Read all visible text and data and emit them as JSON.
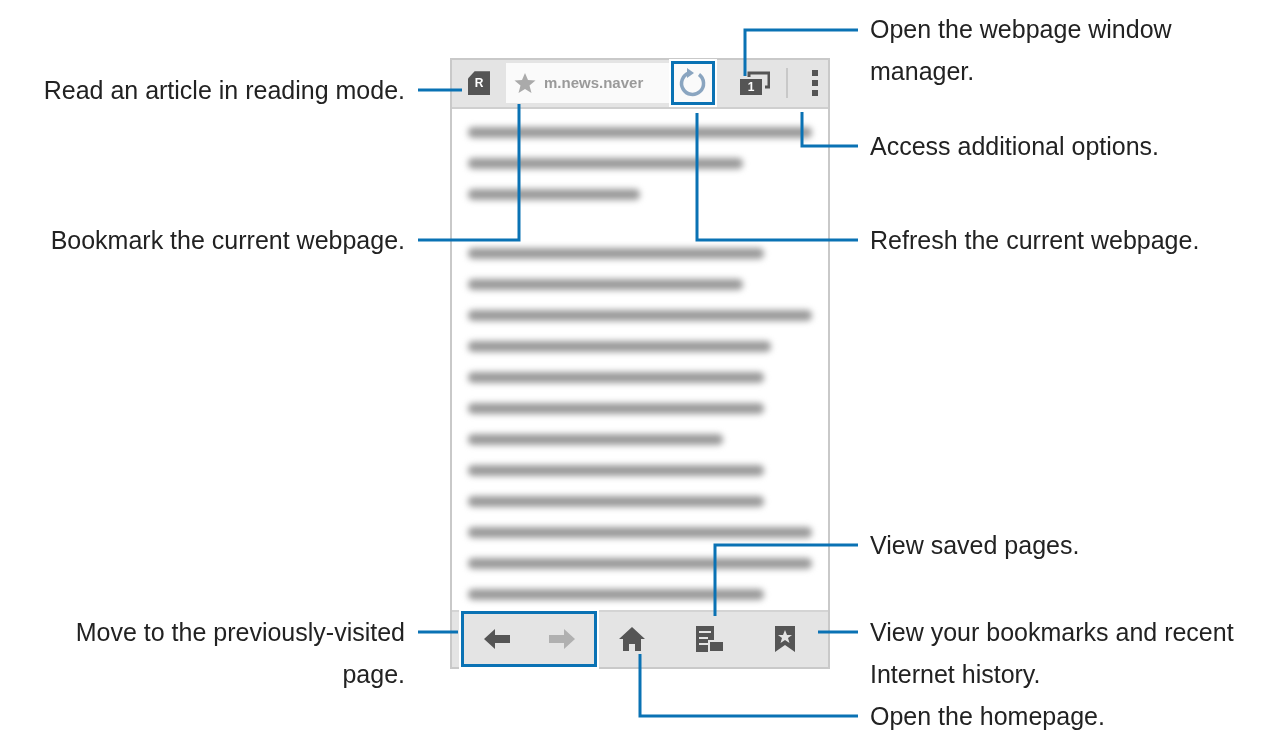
{
  "browser": {
    "reader_button": {
      "letter": "R"
    },
    "address_bar": {
      "url": "m.news.naver"
    },
    "tab_count": "1",
    "navigation": [
      {
        "kind": "back",
        "disabled": false
      },
      {
        "kind": "forward",
        "disabled": true
      }
    ]
  },
  "left_callouts": [
    {
      "lines": [
        "Read an article in reading mode."
      ]
    },
    {
      "lines": [
        "Bookmark the current webpage."
      ]
    },
    {
      "lines": [
        "Move to the previously-visited",
        "page."
      ]
    }
  ],
  "right_callouts": [
    {
      "lines": [
        "Open the webpage window",
        "manager."
      ]
    },
    {
      "lines": [
        "Access additional options."
      ]
    },
    {
      "lines": [
        "Refresh the current webpage."
      ]
    },
    {
      "lines": [
        "View saved pages."
      ]
    },
    {
      "lines": [
        "View your bookmarks and recent",
        "Internet history."
      ]
    },
    {
      "lines": [
        "Open the homepage."
      ]
    }
  ]
}
